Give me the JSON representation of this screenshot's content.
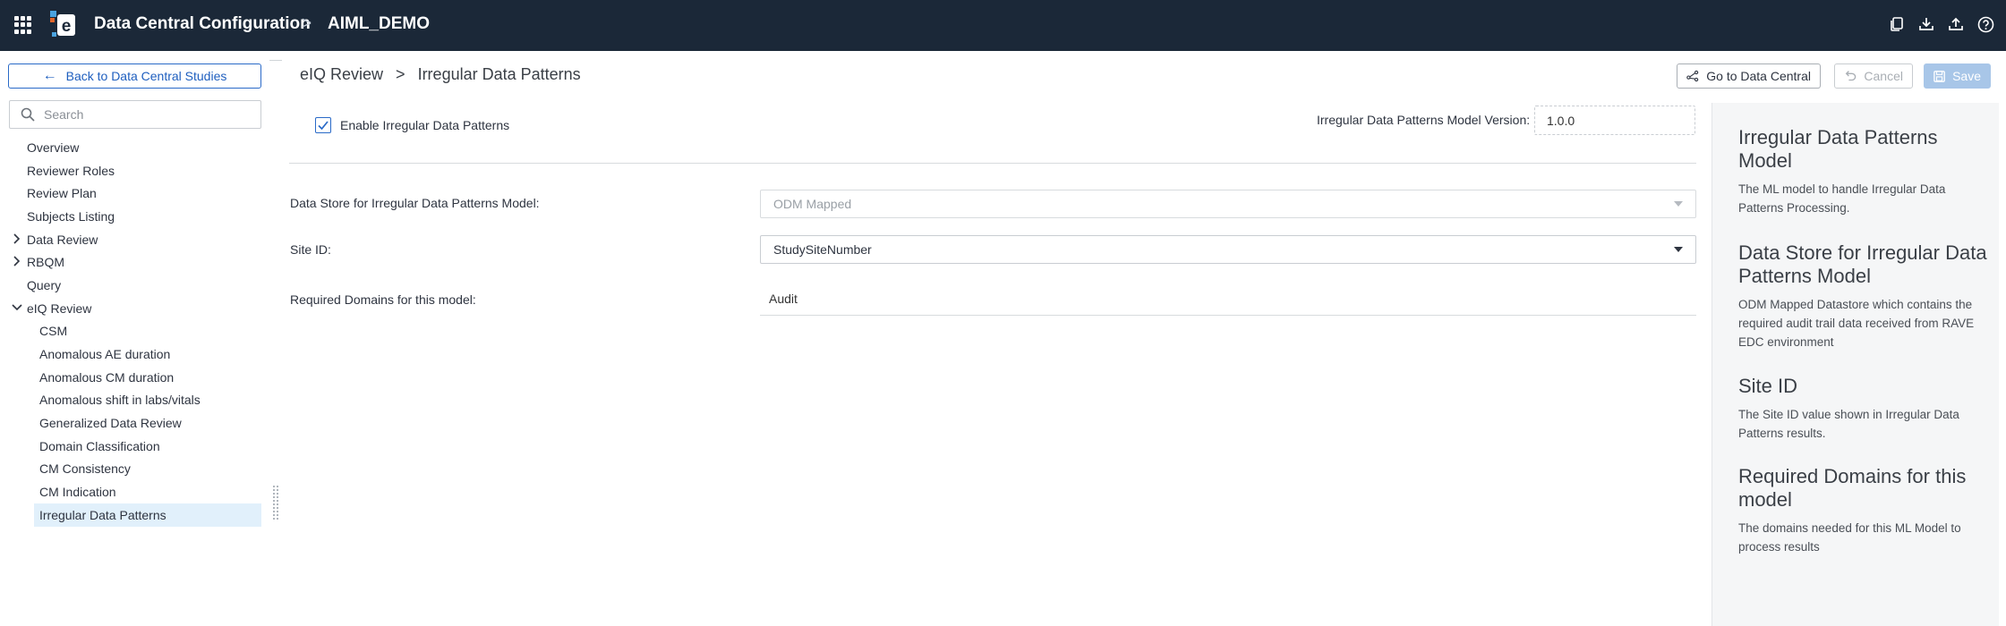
{
  "header": {
    "app_title": "Data Central Configuration",
    "separator": ">",
    "study_name": "AIML_DEMO"
  },
  "sidebar": {
    "back_label": "Back to Data Central Studies",
    "search_placeholder": "Search",
    "items": [
      {
        "label": "Overview"
      },
      {
        "label": "Reviewer Roles"
      },
      {
        "label": "Review Plan"
      },
      {
        "label": "Subjects Listing"
      },
      {
        "label": "Data Review",
        "expandable": true,
        "expanded": false
      },
      {
        "label": "RBQM",
        "expandable": true,
        "expanded": false
      },
      {
        "label": "Query"
      },
      {
        "label": "eIQ Review",
        "expandable": true,
        "expanded": true
      },
      {
        "label": "CSM",
        "child": true
      },
      {
        "label": "Anomalous AE duration",
        "child": true
      },
      {
        "label": "Anomalous CM duration",
        "child": true
      },
      {
        "label": "Anomalous shift in labs/vitals",
        "child": true
      },
      {
        "label": "Generalized Data Review",
        "child": true
      },
      {
        "label": "Domain Classification",
        "child": true
      },
      {
        "label": "CM Consistency",
        "child": true
      },
      {
        "label": "CM Indication",
        "child": true
      },
      {
        "label": "Irregular Data Patterns",
        "child": true,
        "active": true
      }
    ]
  },
  "main": {
    "breadcrumb": {
      "parent": "eIQ Review",
      "separator": ">",
      "current": "Irregular Data Patterns"
    },
    "buttons": {
      "goto": "Go to Data Central",
      "cancel": "Cancel",
      "save": "Save"
    },
    "enable": {
      "label": "Enable Irregular Data Patterns",
      "checked": true
    },
    "version": {
      "label": "Irregular Data Patterns Model Version:",
      "value": "1.0.0"
    },
    "fields": {
      "data_store": {
        "label": "Data Store for Irregular Data Patterns Model:",
        "value": "ODM Mapped"
      },
      "site_id": {
        "label": "Site ID:",
        "value": "StudySiteNumber"
      },
      "required_domains": {
        "label": "Required Domains for this model:",
        "value": "Audit"
      }
    }
  },
  "help": {
    "sections": [
      {
        "title": "Irregular Data Patterns Model",
        "text": "The ML model to handle Irregular Data Patterns Processing."
      },
      {
        "title": "Data Store for Irregular Data Patterns Model",
        "text": "ODM Mapped Datastore which contains the required audit trail data received from RAVE EDC environment"
      },
      {
        "title": "Site ID",
        "text": "The Site ID value shown in Irregular Data Patterns results."
      },
      {
        "title": "Required Domains for this model",
        "text": "The domains needed for this ML Model to process results"
      }
    ]
  },
  "colors": {
    "topbar_bg": "#1b2838",
    "accent": "#2a6ac8",
    "active_nav_bg": "#e1f0fb",
    "help_bg": "#f5f6f7",
    "save_disabled": "#a8c6e8"
  },
  "icons": {
    "apps": "apps-grid-icon",
    "logo": "e-logo-icon",
    "copy": "copy-icon",
    "download": "download-icon",
    "upload": "upload-icon",
    "help": "help-circle-icon",
    "back": "arrow-left-icon",
    "search": "search-icon",
    "goto": "network-share-icon",
    "cancel": "undo-icon",
    "save": "save-icon",
    "caret_right": "chevron-right-icon",
    "caret_down": "chevron-down-icon",
    "check": "check-icon",
    "dropdown": "caret-down-icon"
  }
}
